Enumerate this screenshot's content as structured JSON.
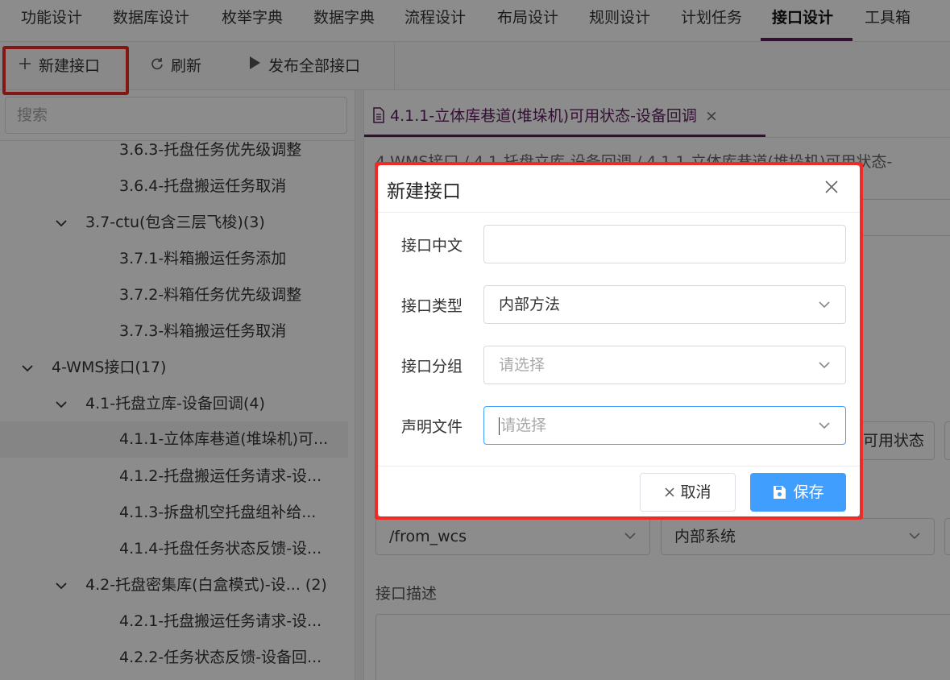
{
  "topnav": {
    "tabs": [
      "功能设计",
      "数据库设计",
      "枚举字典",
      "数据字典",
      "流程设计",
      "布局设计",
      "规则设计",
      "计划任务",
      "接口设计",
      "工具箱"
    ],
    "active_tab": "接口设计"
  },
  "toolbar": {
    "new_label": "新建接口",
    "refresh_label": "刷新",
    "publish_label": "发布全部接口"
  },
  "sidebar": {
    "search_placeholder": "搜索",
    "tree": [
      {
        "label": "3.6.3-托盘任务优先级调整"
      },
      {
        "label": "3.6.4-托盘搬运任务取消"
      },
      {
        "label": "3.7-ctu(包含三层飞梭)",
        "count": "(3)"
      },
      {
        "label": "3.7.1-料箱搬运任务添加"
      },
      {
        "label": "3.7.2-料箱任务优先级调整"
      },
      {
        "label": "3.7.3-料箱搬运任务取消"
      },
      {
        "label": "4-WMS接口",
        "count": "(17)"
      },
      {
        "label": "4.1-托盘立库-设备回调",
        "count": "(4)"
      },
      {
        "label": "4.1.1-立体库巷道(堆垛机)可..."
      },
      {
        "label": "4.1.2-托盘搬运任务请求-设..."
      },
      {
        "label": "4.1.3-拆盘机空托盘组补给..."
      },
      {
        "label": "4.1.4-托盘任务状态反馈-设..."
      },
      {
        "label": "4.2-托盘密集库(白盒模式)-设...",
        "count": "(2)"
      },
      {
        "label": "4.2.1-托盘搬运任务请求-设..."
      },
      {
        "label": "4.2.2-任务状态反馈-设备回..."
      }
    ]
  },
  "main": {
    "open_tab": "4.1.1-立体库巷道(堆垛机)可用状态-设备回调",
    "breadcrumb": "4-WMS接口 / 4.1-托盘立库-设备回调 / 4.1.1-立体库巷道(堆垛机)可用状态-",
    "partial_field_text": "可用状态",
    "route_value": "/from_wcs",
    "system_value": "内部系统",
    "desc_label": "接口描述"
  },
  "dialog": {
    "title": "新建接口",
    "fields": {
      "name_label": "接口中文",
      "name_value": "",
      "type_label": "接口类型",
      "type_value": "内部方法",
      "group_label": "接口分组",
      "group_placeholder": "请选择",
      "file_label": "声明文件",
      "file_placeholder": "请选择"
    },
    "cancel_label": "取消",
    "save_label": "保存"
  },
  "colors": {
    "accent": "#5b1c5e",
    "primary_button": "#409eff",
    "highlight": "#ee2b24"
  }
}
